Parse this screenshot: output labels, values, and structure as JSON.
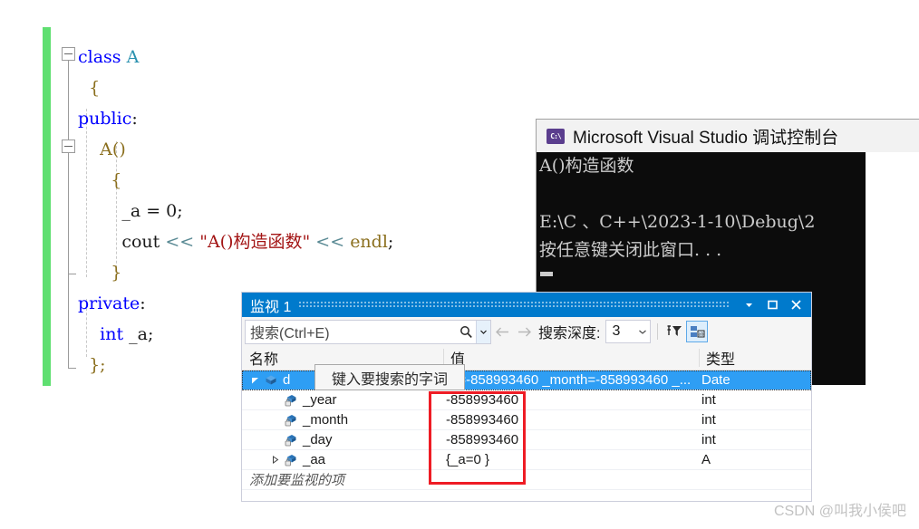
{
  "editor": {
    "name": "code-editor",
    "change_bar_color": "#5fdf71",
    "lines": [
      {
        "indent": 0,
        "tokens": [
          {
            "t": "class",
            "c": "kw"
          },
          {
            "t": " ",
            "c": "pl"
          },
          {
            "t": "A",
            "c": "ty"
          }
        ]
      },
      {
        "indent": 1,
        "tokens": [
          {
            "t": "{",
            "c": "br"
          }
        ]
      },
      {
        "indent": 0,
        "tokens": [
          {
            "t": "public",
            "c": "kw"
          },
          {
            "t": ":",
            "c": "pl"
          }
        ]
      },
      {
        "indent": 2,
        "tokens": [
          {
            "t": "A",
            "c": "fn"
          },
          {
            "t": "()",
            "c": "br"
          }
        ]
      },
      {
        "indent": 3,
        "tokens": [
          {
            "t": "{",
            "c": "br"
          }
        ]
      },
      {
        "indent": 4,
        "tokens": [
          {
            "t": "_a = 0;",
            "c": "pl"
          }
        ]
      },
      {
        "indent": 4,
        "tokens": [
          {
            "t": "cout ",
            "c": "pl"
          },
          {
            "t": "<<",
            "c": "op"
          },
          {
            "t": " ",
            "c": "pl"
          },
          {
            "t": "\"A()构造函数\"",
            "c": "st"
          },
          {
            "t": " ",
            "c": "pl"
          },
          {
            "t": "<<",
            "c": "op"
          },
          {
            "t": " ",
            "c": "pl"
          },
          {
            "t": "endl",
            "c": "fn"
          },
          {
            "t": ";",
            "c": "pl"
          }
        ]
      },
      {
        "indent": 3,
        "tokens": [
          {
            "t": "}",
            "c": "br"
          }
        ]
      },
      {
        "indent": 0,
        "tokens": [
          {
            "t": "private",
            "c": "kw"
          },
          {
            "t": ":",
            "c": "pl"
          }
        ]
      },
      {
        "indent": 2,
        "tokens": [
          {
            "t": "int",
            "c": "kw"
          },
          {
            "t": " _a;",
            "c": "pl"
          }
        ]
      },
      {
        "indent": 1,
        "tokens": [
          {
            "t": "};",
            "c": "br"
          }
        ]
      }
    ]
  },
  "console": {
    "title": "Microsoft Visual Studio 调试控制台",
    "icon": "console-app-icon",
    "icon_text": "C:\\",
    "lines": [
      "A()构造函数",
      "",
      "E:\\C 、C++\\2023-1-10\\Debug\\2",
      "按任意键关闭此窗口. . ."
    ]
  },
  "watch": {
    "title": "监视 1",
    "title_buttons": [
      {
        "name": "window-dropdown-button",
        "glyph": "chevron-down-icon"
      },
      {
        "name": "window-maximize-button",
        "glyph": "maximize-icon"
      },
      {
        "name": "window-close-button",
        "glyph": "close-icon"
      }
    ],
    "toolbar": {
      "search_value": "搜索(Ctrl+E)",
      "search_placeholder": "搜索(Ctrl+E)",
      "search_icon": "search-icon",
      "search_dropdown_icon": "chevron-down-icon",
      "nav_back_icon": "arrow-left-icon",
      "nav_forward_icon": "arrow-right-icon",
      "depth_label": "搜索深度:",
      "depth_value": "3",
      "depth_caret": "chevron-down-icon",
      "filter_icon": "pin-filter-icon",
      "hex_icon": "hex-display-icon"
    },
    "columns": [
      "名称",
      "值",
      "类型"
    ],
    "rows": [
      {
        "name": "d",
        "value": "ar=-858993460 _month=-858993460 _...",
        "type": "Date",
        "indent": 0,
        "expander": "expanded",
        "icon": "object-icon",
        "selected": true
      },
      {
        "name": "_year",
        "value": "-858993460",
        "type": "int",
        "indent": 1,
        "expander": "none",
        "icon": "field-private-icon",
        "selected": false
      },
      {
        "name": "_month",
        "value": "-858993460",
        "type": "int",
        "indent": 1,
        "expander": "none",
        "icon": "field-private-icon",
        "selected": false
      },
      {
        "name": "_day",
        "value": "-858993460",
        "type": "int",
        "indent": 1,
        "expander": "none",
        "icon": "field-private-icon",
        "selected": false
      },
      {
        "name": "_aa",
        "value": "{_a=0 }",
        "type": "A",
        "indent": 1,
        "expander": "collapsed",
        "icon": "field-private-icon",
        "selected": false
      }
    ],
    "add_row_text": "添加要监视的项",
    "highlight_color": "#ee1c25"
  },
  "tooltip": {
    "text": "键入要搜索的字词"
  },
  "watermark": {
    "text": "CSDN @叫我小侯吧"
  }
}
